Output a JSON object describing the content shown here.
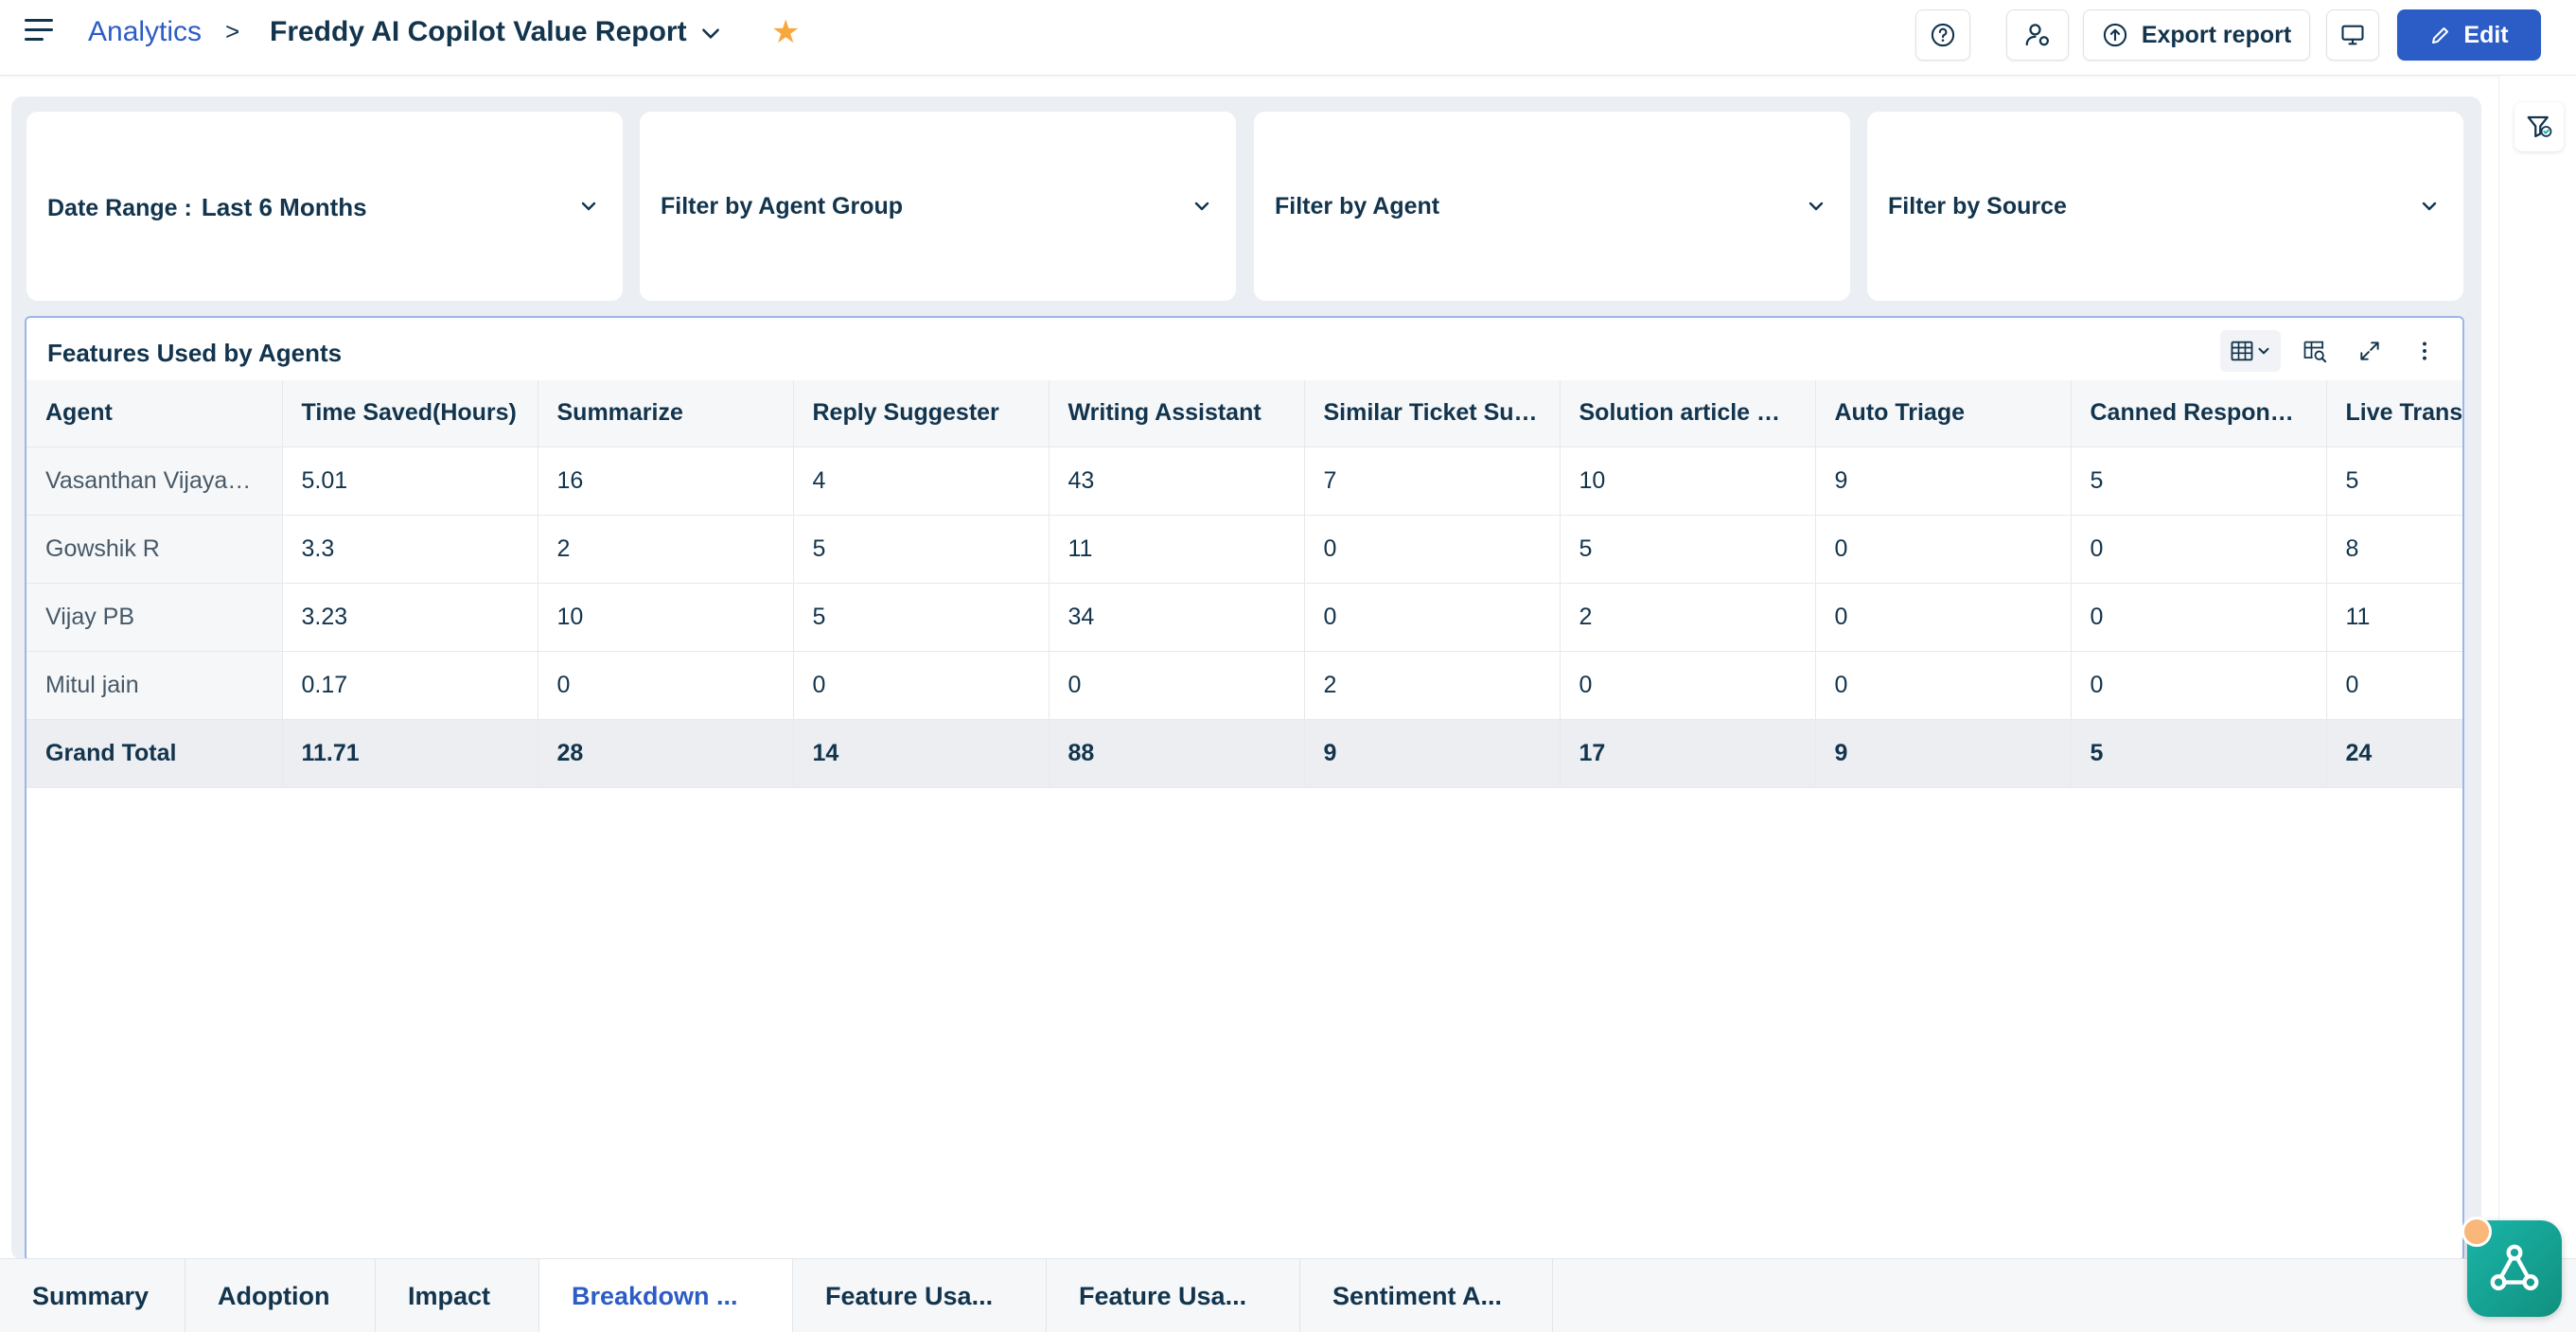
{
  "header": {
    "breadcrumb_root": "Analytics",
    "breadcrumb_separator": ">",
    "report_title": "Freddy AI Copilot Value Report",
    "export_label": "Export report",
    "edit_label": "Edit"
  },
  "filters": [
    {
      "label": "Date Range :",
      "value": "Last 6 Months"
    },
    {
      "label": "Filter by Agent Group",
      "value": ""
    },
    {
      "label": "Filter by Agent",
      "value": ""
    },
    {
      "label": "Filter by Source",
      "value": ""
    }
  ],
  "widget": {
    "title": "Features Used by Agents",
    "columns": [
      "Agent",
      "Time Saved(Hours)",
      "Summarize",
      "Reply Suggester",
      "Writing Assistant",
      "Similar Ticket Sug...",
      "Solution article Su...",
      "Auto Triage",
      "Canned Response...",
      "Live Transl"
    ],
    "rows": [
      [
        "Vasanthan Vijayaku...",
        "5.01",
        "16",
        "4",
        "43",
        "7",
        "10",
        "9",
        "5",
        "5"
      ],
      [
        "Gowshik R",
        "3.3",
        "2",
        "5",
        "11",
        "0",
        "5",
        "0",
        "0",
        "8"
      ],
      [
        "Vijay PB",
        "3.23",
        "10",
        "5",
        "34",
        "0",
        "2",
        "0",
        "0",
        "11"
      ],
      [
        "Mitul jain",
        "0.17",
        "0",
        "0",
        "0",
        "2",
        "0",
        "0",
        "0",
        "0"
      ]
    ],
    "total": [
      "Grand Total",
      "11.71",
      "28",
      "14",
      "88",
      "9",
      "17",
      "9",
      "5",
      "24"
    ]
  },
  "tabs": [
    {
      "label": "Summary",
      "active": false
    },
    {
      "label": "Adoption",
      "active": false
    },
    {
      "label": "Impact",
      "active": false
    },
    {
      "label": "Breakdown ...",
      "active": true
    },
    {
      "label": "Feature Usa...",
      "active": false
    },
    {
      "label": "Feature Usa...",
      "active": false
    },
    {
      "label": "Sentiment A...",
      "active": false
    }
  ],
  "colors": {
    "accent": "#2c5cc5",
    "star": "#f7a83c",
    "assistant": "#1ab5a8"
  }
}
